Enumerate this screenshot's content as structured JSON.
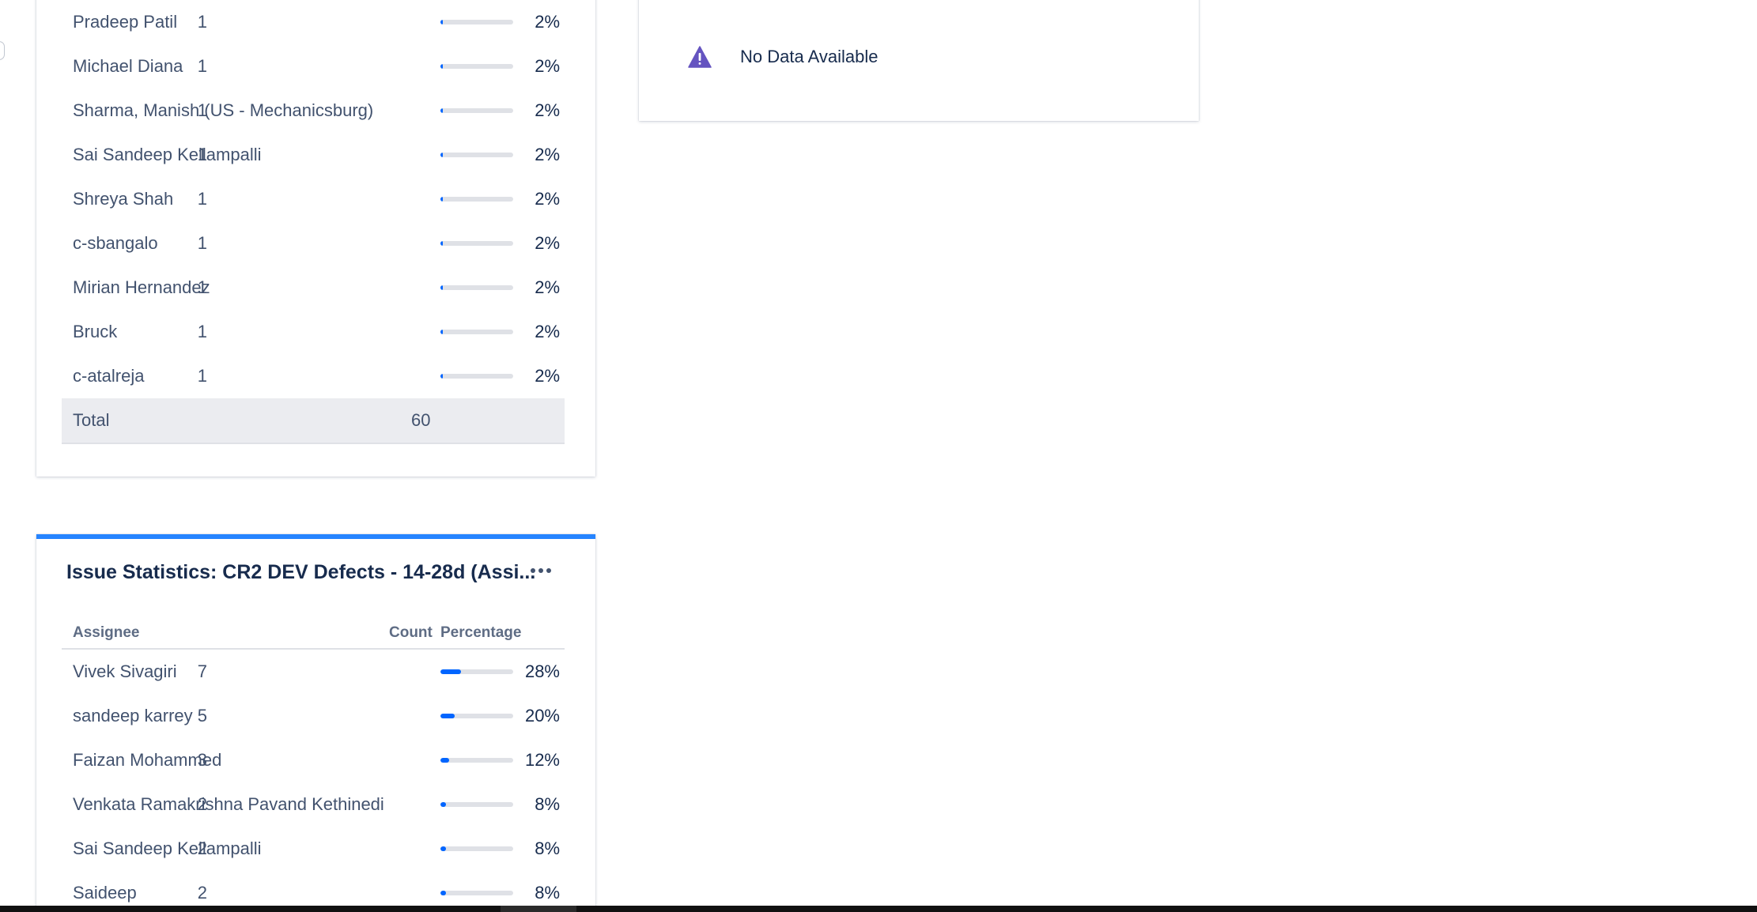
{
  "top_gadget": {
    "rows": [
      {
        "name": "Pradeep Patil",
        "count": "1",
        "percentage": "2%",
        "fill": 0.02
      },
      {
        "name": "Michael Diana",
        "count": "1",
        "percentage": "2%",
        "fill": 0.02
      },
      {
        "name": "Sharma, Manish (US - Mechanicsburg)",
        "count": "1",
        "percentage": "2%",
        "fill": 0.02
      },
      {
        "name": "Sai Sandeep Kellampalli",
        "count": "1",
        "percentage": "2%",
        "fill": 0.02
      },
      {
        "name": "Shreya Shah",
        "count": "1",
        "percentage": "2%",
        "fill": 0.02
      },
      {
        "name": "c-sbangalo",
        "count": "1",
        "percentage": "2%",
        "fill": 0.02
      },
      {
        "name": "Mirian Hernandez",
        "count": "1",
        "percentage": "2%",
        "fill": 0.02
      },
      {
        "name": "Bruck",
        "count": "1",
        "percentage": "2%",
        "fill": 0.02
      },
      {
        "name": "c-atalreja",
        "count": "1",
        "percentage": "2%",
        "fill": 0.02
      }
    ],
    "total_label": "Total",
    "total_value": "60"
  },
  "no_data_gadget": {
    "message": "No Data Available",
    "icon": "warning-icon",
    "icon_color": "#6554c0"
  },
  "stats_gadget": {
    "title": "Issue Statistics: CR2 DEV Defects - 14-28d (Assi...",
    "more_icon": "more-actions-icon",
    "accent_color": "#2684ff",
    "columns": {
      "assignee": "Assignee",
      "count": "Count",
      "percentage": "Percentage"
    },
    "rows": [
      {
        "name": "Vivek Sivagiri",
        "count": "7",
        "percentage": "28%",
        "fill": 0.28
      },
      {
        "name": "sandeep karrey",
        "count": "5",
        "percentage": "20%",
        "fill": 0.2
      },
      {
        "name": "Faizan Mohammed",
        "count": "3",
        "percentage": "12%",
        "fill": 0.12
      },
      {
        "name": "Venkata Ramakrishna Pavand Kethinedi",
        "count": "2",
        "percentage": "8%",
        "fill": 0.08
      },
      {
        "name": "Sai Sandeep Kellampalli",
        "count": "2",
        "percentage": "8%",
        "fill": 0.08
      },
      {
        "name": "Saideep",
        "count": "2",
        "percentage": "8%",
        "fill": 0.08
      }
    ]
  },
  "colors": {
    "bar_fill": "#0065ff",
    "bar_track": "#dfe1e6",
    "total_row_bg": "#ebecf0"
  }
}
